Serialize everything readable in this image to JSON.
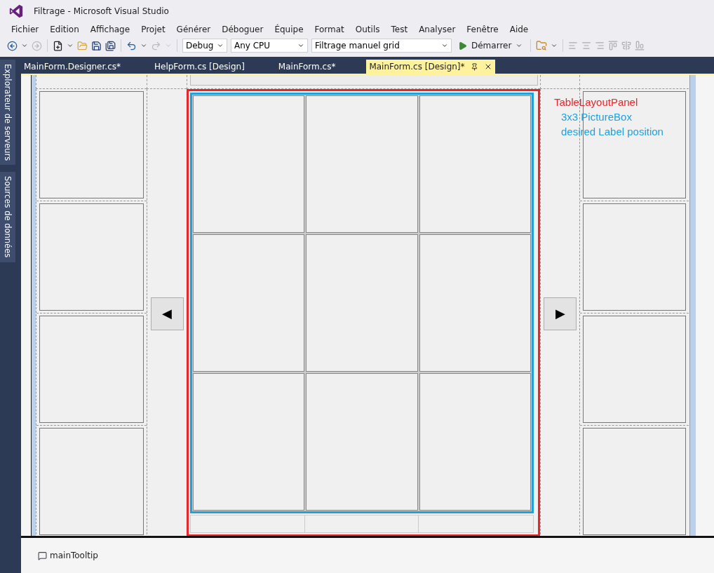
{
  "window": {
    "title": "Filtrage - Microsoft Visual Studio"
  },
  "menu": [
    "Fichier",
    "Edition",
    "Affichage",
    "Projet",
    "Générer",
    "Déboguer",
    "Équipe",
    "Format",
    "Outils",
    "Test",
    "Analyser",
    "Fenêtre",
    "Aide"
  ],
  "toolbar": {
    "configuration": "Debug",
    "platform": "Any CPU",
    "project": "Filtrage manuel grid",
    "start": "Démarrer"
  },
  "side_tabs": [
    "Explorateur de serveurs",
    "Sources de données"
  ],
  "tabs": [
    {
      "label": "MainForm.Designer.cs*",
      "selected": false
    },
    {
      "label": "HelpForm.cs [Design]",
      "selected": false
    },
    {
      "label": "MainForm.cs*",
      "selected": false
    },
    {
      "label": "MainForm.cs [Design]*",
      "selected": true
    }
  ],
  "form": {
    "prev_button": "◀",
    "next_button": "▶"
  },
  "annotations": [
    {
      "text": "TableLayoutPanel",
      "color": "#e8262b"
    },
    {
      "text": "3x3 PictureBox",
      "color": "#1fa1dc"
    },
    {
      "text": "desired Label position",
      "color": "#1fa1dc"
    }
  ],
  "component_tray": [
    "mainTooltip"
  ]
}
